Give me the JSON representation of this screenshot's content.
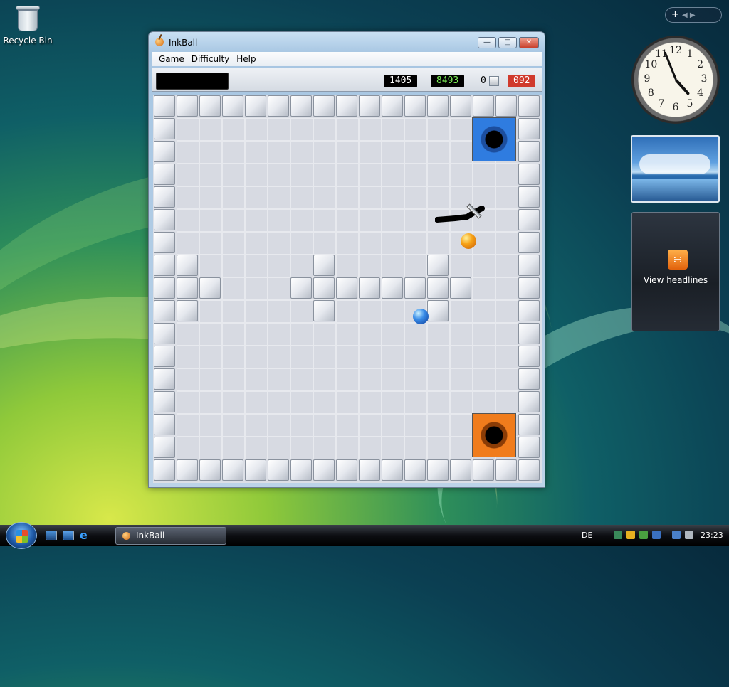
{
  "desktop": {
    "recycle_bin_label": "Recycle Bin"
  },
  "window": {
    "title": "InkBall",
    "menu": [
      "Game",
      "Difficulty",
      "Help"
    ],
    "scores": {
      "score_1": "1405",
      "score_2": "8493",
      "lost_count": "0",
      "timer": "092"
    }
  },
  "board": {
    "cols": 17,
    "rows": 17,
    "walls": [
      [
        1,
        7
      ],
      [
        1,
        8
      ],
      [
        2,
        8
      ],
      [
        1,
        9
      ],
      [
        7,
        7
      ],
      [
        6,
        8
      ],
      [
        7,
        8
      ],
      [
        8,
        8
      ],
      [
        9,
        8
      ],
      [
        10,
        8
      ],
      [
        11,
        8
      ],
      [
        12,
        8
      ],
      [
        13,
        8
      ],
      [
        7,
        9
      ],
      [
        12,
        7
      ],
      [
        12,
        9
      ]
    ],
    "holes": [
      {
        "color": "blue",
        "col": 14,
        "row": 1
      },
      {
        "color": "orange",
        "col": 14,
        "row": 14
      }
    ],
    "balls": [
      {
        "color": "orange",
        "col": 13.5,
        "row": 6.1
      },
      {
        "color": "blue",
        "col": 11.4,
        "row": 9.4
      }
    ]
  },
  "gadgets": {
    "sidebar_controls": "+",
    "clock_numbers": [
      "12",
      "1",
      "2",
      "3",
      "4",
      "5",
      "6",
      "7",
      "8",
      "9",
      "10",
      "11"
    ],
    "rss_label": "View headlines"
  },
  "taskbar": {
    "task_label": "InkBall",
    "language": "DE",
    "time": "23:23"
  }
}
